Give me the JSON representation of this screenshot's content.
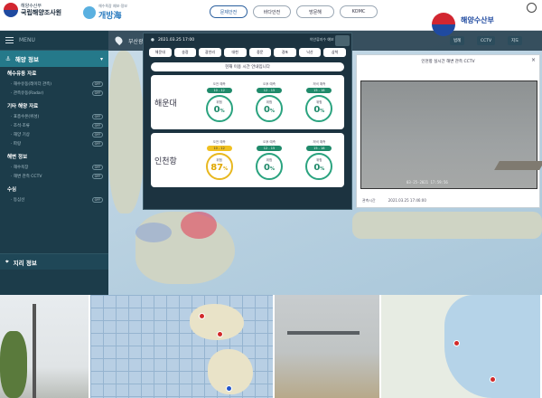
{
  "header": {
    "org_small": "해양수산부",
    "org_name": "국립해양조사원",
    "service_small": "해수욕장 예보·정보",
    "service_name": "개방海",
    "tabs": [
      {
        "label": "문제안전",
        "active": true
      },
      {
        "label": "바다안전",
        "active": false
      },
      {
        "label": "방문해",
        "active": false
      },
      {
        "label": "KOMC",
        "active": false
      }
    ],
    "ministry_logo_text": "해양수산부"
  },
  "sidebar": {
    "menu_label": "MENU",
    "section1": {
      "title": "해양 정보"
    },
    "groups": [
      {
        "title": "해수유동 자료",
        "items": [
          {
            "label": "· 해수유동(레이더 관측)",
            "toggle": "OFF"
          },
          {
            "label": "· 관측유동(Radar)",
            "toggle": "OFF"
          }
        ]
      },
      {
        "title": "기타 해양 자료",
        "items": [
          {
            "label": "· 표층수온(위성)",
            "toggle": "OFF"
          },
          {
            "label": "· 조석·조류",
            "toggle": "OFF"
          },
          {
            "label": "· 해양 기상",
            "toggle": "OFF"
          },
          {
            "label": "· 파랑",
            "toggle": "OFF"
          }
        ]
      },
      {
        "title": "해변 정보",
        "items": [
          {
            "label": "· 해수욕장",
            "toggle": "OFF"
          },
          {
            "label": "· 해변 관측 CCTV",
            "toggle": "OFF"
          }
        ]
      },
      {
        "title": "수심",
        "items": [
          {
            "label": "· 등심선",
            "toggle": "OFF"
          }
        ]
      }
    ],
    "section2": {
      "title": "지리 정보"
    }
  },
  "map": {
    "location_label": "부산광역시",
    "toolbar_buttons": [
      "범례",
      "CCTV",
      "지도"
    ]
  },
  "panel": {
    "datetime": "2021.03.25 17:00",
    "now_label": "이안류지수 예보 / 분석",
    "beach_tabs": [
      "해운대",
      "송정",
      "광안리",
      "대천",
      "중문",
      "경포",
      "낙산",
      "삼척"
    ],
    "notice": "현재 이용 시간 안내입니다",
    "cards": [
      {
        "name": "해운대",
        "gauges": [
          {
            "sub": "오전 예측",
            "time": "10 - 12",
            "label": "위험",
            "value": "0",
            "warn": false
          },
          {
            "sub": "오후 예측",
            "time": "12 - 15",
            "label": "위험",
            "value": "0",
            "warn": false
          },
          {
            "sub": "저녁 예측",
            "time": "15 - 18",
            "label": "위험",
            "value": "0",
            "warn": false
          }
        ]
      },
      {
        "name": "인천항",
        "gauges": [
          {
            "sub": "오전 예측",
            "time": "10 - 12",
            "label": "위험",
            "value": "87",
            "warn": true
          },
          {
            "sub": "오후 예측",
            "time": "12 - 15",
            "label": "위험",
            "value": "0",
            "warn": false
          },
          {
            "sub": "저녁 예측",
            "time": "15 - 18",
            "label": "위험",
            "value": "0",
            "warn": false
          }
        ]
      }
    ],
    "percent_unit": "%"
  },
  "cctv": {
    "title": "인천항 실시간 해변 관측 CCTV",
    "timestamp_overlay": "03-25-2021 17:59:56",
    "foot_label": "관측시간",
    "foot_value": "2021.03.25 17:46:00"
  }
}
